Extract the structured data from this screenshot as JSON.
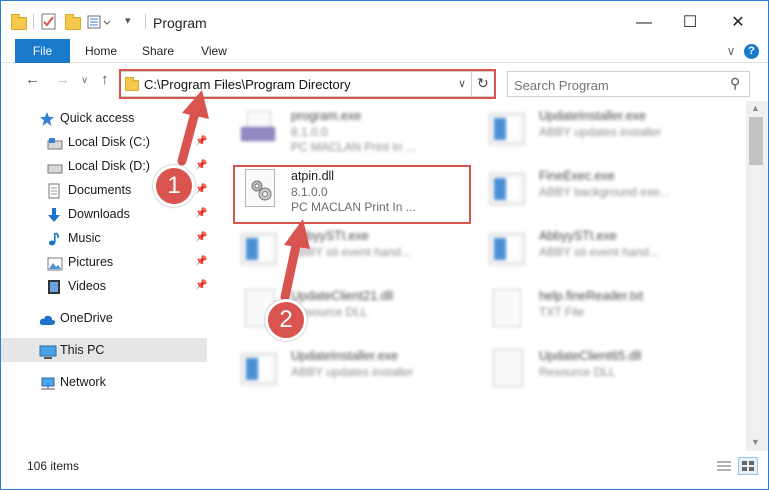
{
  "window": {
    "title": "Program",
    "minimize_glyph": "—",
    "maximize_glyph": "☐",
    "close_glyph": "✕",
    "help_glyph": "?"
  },
  "ribbon": {
    "tabs": [
      "File",
      "Home",
      "Share",
      "View"
    ],
    "expand_glyph": "∨"
  },
  "address": {
    "path": "C:\\Program Files\\Program Directory",
    "dropdown_glyph": "∨",
    "refresh_glyph": "↻"
  },
  "nav_buttons": {
    "back": "←",
    "forward": "→",
    "recent": "∨",
    "up": "↑"
  },
  "search": {
    "placeholder": "Search Program",
    "icon_glyph": "⚲"
  },
  "sidebar": {
    "items": [
      {
        "label": "Quick access",
        "icon": "star-icon",
        "pinned": false
      },
      {
        "label": "Local Disk (C:)",
        "icon": "drive-icon",
        "pinned": true
      },
      {
        "label": "Local Disk (D:)",
        "icon": "drive-icon",
        "pinned": true
      },
      {
        "label": "Documents",
        "icon": "documents-icon",
        "pinned": true
      },
      {
        "label": "Downloads",
        "icon": "download-icon",
        "pinned": true
      },
      {
        "label": "Music",
        "icon": "music-icon",
        "pinned": true
      },
      {
        "label": "Pictures",
        "icon": "pictures-icon",
        "pinned": true
      },
      {
        "label": "Videos",
        "icon": "videos-icon",
        "pinned": true
      },
      {
        "label": "OneDrive",
        "icon": "cloud-icon",
        "pinned": false
      },
      {
        "label": "This PC",
        "icon": "computer-icon",
        "pinned": false
      },
      {
        "label": "Network",
        "icon": "network-icon",
        "pinned": false
      }
    ],
    "pin_glyph": "📌"
  },
  "files": [
    {
      "name": "program.exe",
      "line1": "8.1.0.0",
      "line2": "PC MACLAN Print In ...",
      "icon": "setup-icon"
    },
    {
      "name": "UpdateInstaller.exe",
      "line1": "ABBY updates installer",
      "line2": "",
      "icon": "app-icon"
    },
    {
      "name": "atpin.dll",
      "line1": "8.1.0.0",
      "line2": "PC MACLAN Print In ...",
      "icon": "dll-gear-icon"
    },
    {
      "name": "FineExec.exe",
      "line1": "ABBY background exe...",
      "line2": "",
      "icon": "app-icon"
    },
    {
      "name": "AbbyySTI.exe",
      "line1": "ABBY sti event hand...",
      "line2": "",
      "icon": "app-icon"
    },
    {
      "name": "AbbyySTI.exe",
      "line1": "ABBY sti event hand...",
      "line2": "",
      "icon": "app-icon"
    },
    {
      "name": "UpdateClient21.dll",
      "line1": "Resource DLL",
      "line2": "",
      "icon": "dll-gear-icon"
    },
    {
      "name": "help.fineReader.txt",
      "line1": "TXT File",
      "line2": "",
      "icon": "text-file-icon"
    },
    {
      "name": "UpdateInstaller.exe",
      "line1": "ABBY updates installer",
      "line2": "",
      "icon": "app-icon"
    },
    {
      "name": "UpdateClient65.dll",
      "line1": "Resource DLL",
      "line2": "",
      "icon": "dll-gear-icon"
    }
  ],
  "status": {
    "item_count": "106 items"
  },
  "annotations": {
    "step1": "1",
    "step2": "2"
  },
  "colors": {
    "accent": "#1979ca",
    "highlight": "#d9534f",
    "selected_nav": "#e6e6e6"
  }
}
